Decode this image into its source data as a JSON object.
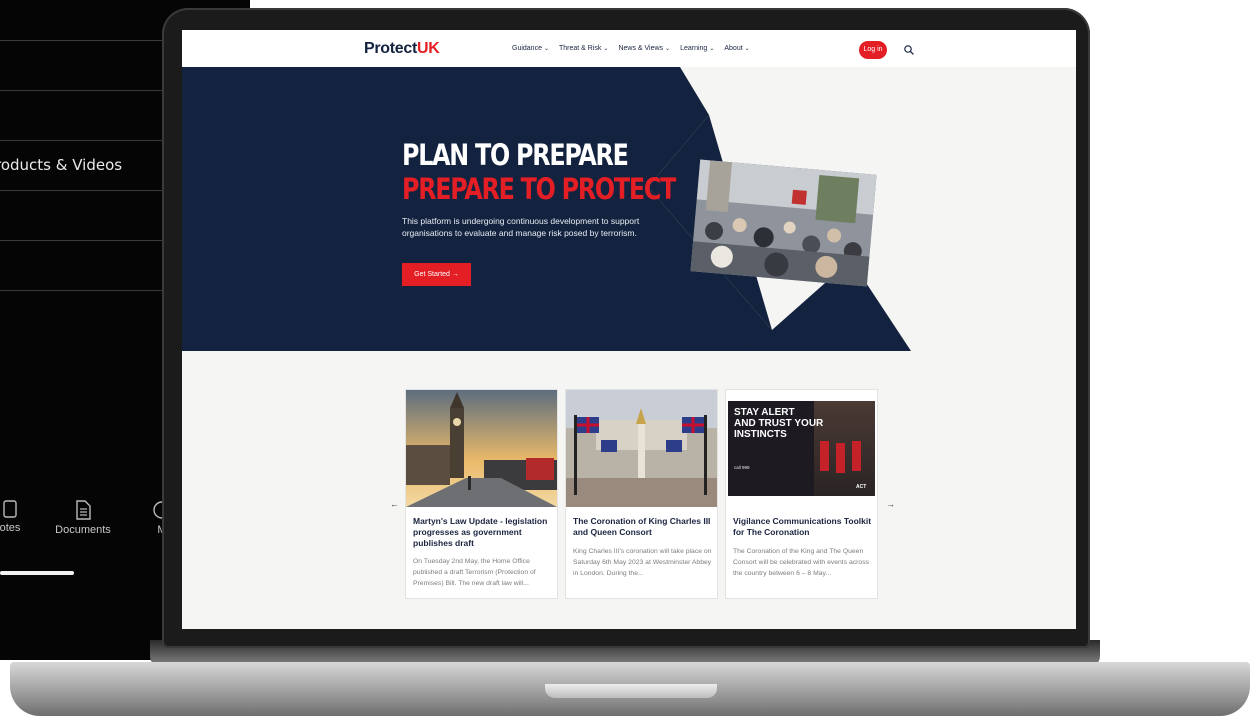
{
  "phone": {
    "menu_items": [
      "",
      "",
      "roducts & Videos",
      "",
      ""
    ],
    "tabs": [
      {
        "label": "otes",
        "icon": "notes-icon"
      },
      {
        "label": "Documents",
        "icon": "documents-icon"
      },
      {
        "label": "M",
        "icon": "more-icon"
      }
    ]
  },
  "site": {
    "logo_protect": "Protect",
    "logo_uk": "UK",
    "nav": [
      "Guidance",
      "Threat & Risk",
      "News & Views",
      "Learning",
      "About"
    ],
    "login_label": "Log in",
    "search_icon": "search-icon"
  },
  "hero": {
    "title_line1": "PLAN TO PREPARE",
    "title_line2": "PREPARE TO PROTECT",
    "text": "This platform is undergoing continuous development to support organisations to evaluate and manage risk posed by terrorism.",
    "button_label": "Get Started →"
  },
  "carousel": {
    "prev_label": "←",
    "next_label": "→",
    "cards": [
      {
        "title": "Martyn's Law Update - legislation progresses as government publishes draft",
        "body": "On Tuesday 2nd May, the Home Office published a draft Terrorism (Protection of Premises) Bill. The new draft law will..."
      },
      {
        "title": "The Coronation of King Charles III and Queen Consort",
        "body": "King Charles III's coronation will take place on Saturday 6th May 2023 at Westminster Abbey in London. During the..."
      },
      {
        "title": "Vigilance Communications Toolkit for The Coronation",
        "body": "The Coronation of the King and The Queen Consort will be celebrated with events across the country between 6 – 8 May...",
        "poster_line1": "STAY ALERT",
        "poster_line2": "AND TRUST YOUR",
        "poster_line3": "INSTINCTS",
        "poster_call": "call 999",
        "poster_act": "ACT"
      }
    ]
  },
  "colors": {
    "navy": "#13233f",
    "brand_red": "#e31e24",
    "page_bg": "#f5f5f3"
  }
}
